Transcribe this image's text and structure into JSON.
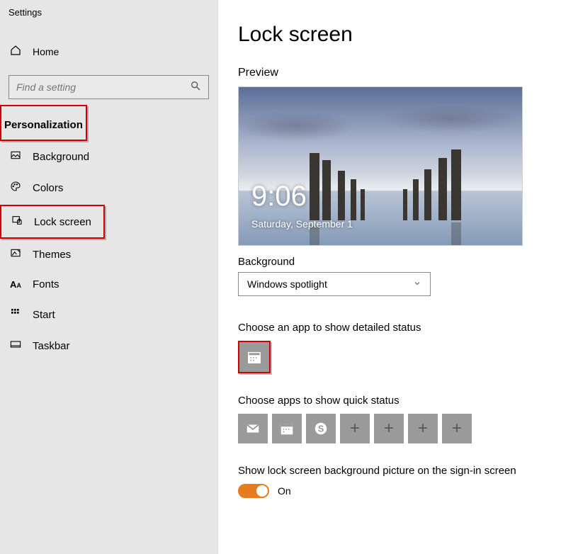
{
  "app": {
    "title": "Settings"
  },
  "sidebar": {
    "home": "Home",
    "search_placeholder": "Find a setting",
    "category": "Personalization",
    "items": [
      {
        "label": "Background"
      },
      {
        "label": "Colors"
      },
      {
        "label": "Lock screen"
      },
      {
        "label": "Themes"
      },
      {
        "label": "Fonts"
      },
      {
        "label": "Start"
      },
      {
        "label": "Taskbar"
      }
    ]
  },
  "page": {
    "title": "Lock screen",
    "preview_label": "Preview",
    "preview_time": "9:06",
    "preview_date": "Saturday, September 1",
    "background_label": "Background",
    "background_value": "Windows spotlight",
    "detailed_label": "Choose an app to show detailed status",
    "quick_label": "Choose apps to show quick status",
    "signin_label": "Show lock screen background picture on the sign-in screen",
    "toggle_state": "On"
  }
}
